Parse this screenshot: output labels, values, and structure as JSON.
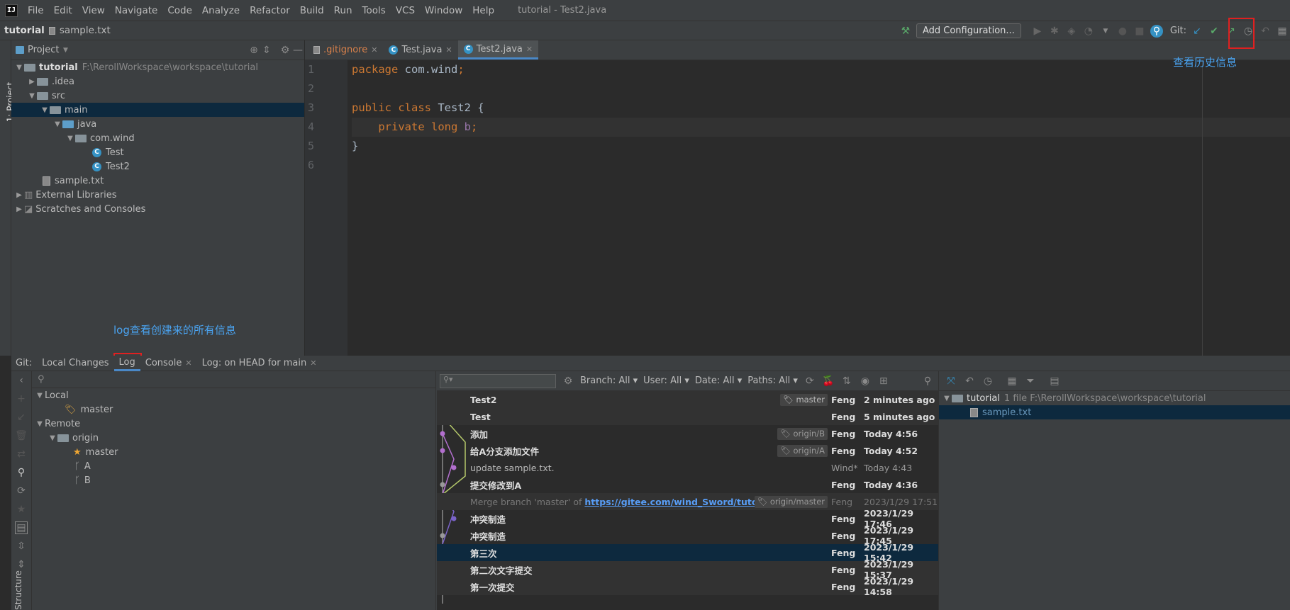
{
  "app": {
    "title": "tutorial - Test2.java",
    "logo": "IJ"
  },
  "menu": [
    "File",
    "Edit",
    "View",
    "Navigate",
    "Code",
    "Analyze",
    "Refactor",
    "Build",
    "Run",
    "Tools",
    "VCS",
    "Window",
    "Help"
  ],
  "navbar": {
    "project": "tutorial",
    "file": "sample.txt",
    "add_config": "Add Configuration...",
    "git_label": "Git:"
  },
  "left_tool": {
    "label": "1: Project",
    "bottom_label": "Structure"
  },
  "project": {
    "header": "Project",
    "root": {
      "name": "tutorial",
      "path": "F:\\RerollWorkspace\\workspace\\tutorial"
    },
    "items": [
      ".idea",
      "src",
      "main",
      "java",
      "com.wind",
      "Test",
      "Test2",
      "sample.txt",
      "External Libraries",
      "Scratches and Consoles"
    ]
  },
  "editor": {
    "tabs": [
      ".gitignore",
      "Test.java",
      "Test2.java"
    ],
    "line_numbers": [
      "1",
      "2",
      "3",
      "4",
      "5",
      "6"
    ]
  },
  "annotations": {
    "history": "查看历史信息",
    "log": "log查看创建来的所有信息"
  },
  "bottom": {
    "tabs": [
      "Git:",
      "Local Changes",
      "Log",
      "Console",
      "Log: on HEAD for main"
    ],
    "branches": {
      "local": "Local",
      "local_master": "master",
      "remote": "Remote",
      "origin": "origin",
      "origin_master": "master",
      "a": "A",
      "b": "B"
    },
    "filters": {
      "branch": "Branch: All",
      "user": "User: All",
      "date": "Date: All",
      "paths": "Paths: All"
    },
    "commits": [
      {
        "msg": "Test2",
        "tag": "master",
        "author": "Feng",
        "date": "2 minutes ago"
      },
      {
        "msg": "Test",
        "tag": "",
        "author": "Feng",
        "date": "5 minutes ago"
      },
      {
        "msg": "添加",
        "tag": "origin/B",
        "author": "Feng",
        "date": "Today 4:56"
      },
      {
        "msg": "给A分支添加文件",
        "tag": "origin/A",
        "author": "Feng",
        "date": "Today 4:52"
      },
      {
        "msg": "update sample.txt.",
        "tag": "",
        "author": "Wind*",
        "date": "Today 4:43"
      },
      {
        "msg": "提交修改到A",
        "tag": "",
        "author": "Feng",
        "date": "Today 4:36"
      },
      {
        "msg": "Merge branch 'master' of",
        "link": "https://gitee.com/wind_Sword/tutorial",
        "tag": "origin/master",
        "author": "Feng",
        "date": "2023/1/29 17:51"
      },
      {
        "msg": "冲突制造",
        "tag": "",
        "author": "Feng",
        "date": "2023/1/29 17:46"
      },
      {
        "msg": "冲突制造",
        "tag": "",
        "author": "Feng",
        "date": "2023/1/29 17:45"
      },
      {
        "msg": "第三次",
        "tag": "",
        "author": "Feng",
        "date": "2023/1/29 15:42"
      },
      {
        "msg": "第二次文字提交",
        "tag": "",
        "author": "Feng",
        "date": "2023/1/29 15:37"
      },
      {
        "msg": "第一次提交",
        "tag": "",
        "author": "Feng",
        "date": "2023/1/29 14:58"
      }
    ],
    "details": {
      "root": "tutorial",
      "summary": "1 file  F:\\RerollWorkspace\\workspace\\tutorial",
      "file": "sample.txt"
    }
  },
  "colors": {
    "accent": "#4a88c7",
    "annotation": "#4aa3f0",
    "redbox": "#e02020",
    "selection": "#0d293e"
  }
}
